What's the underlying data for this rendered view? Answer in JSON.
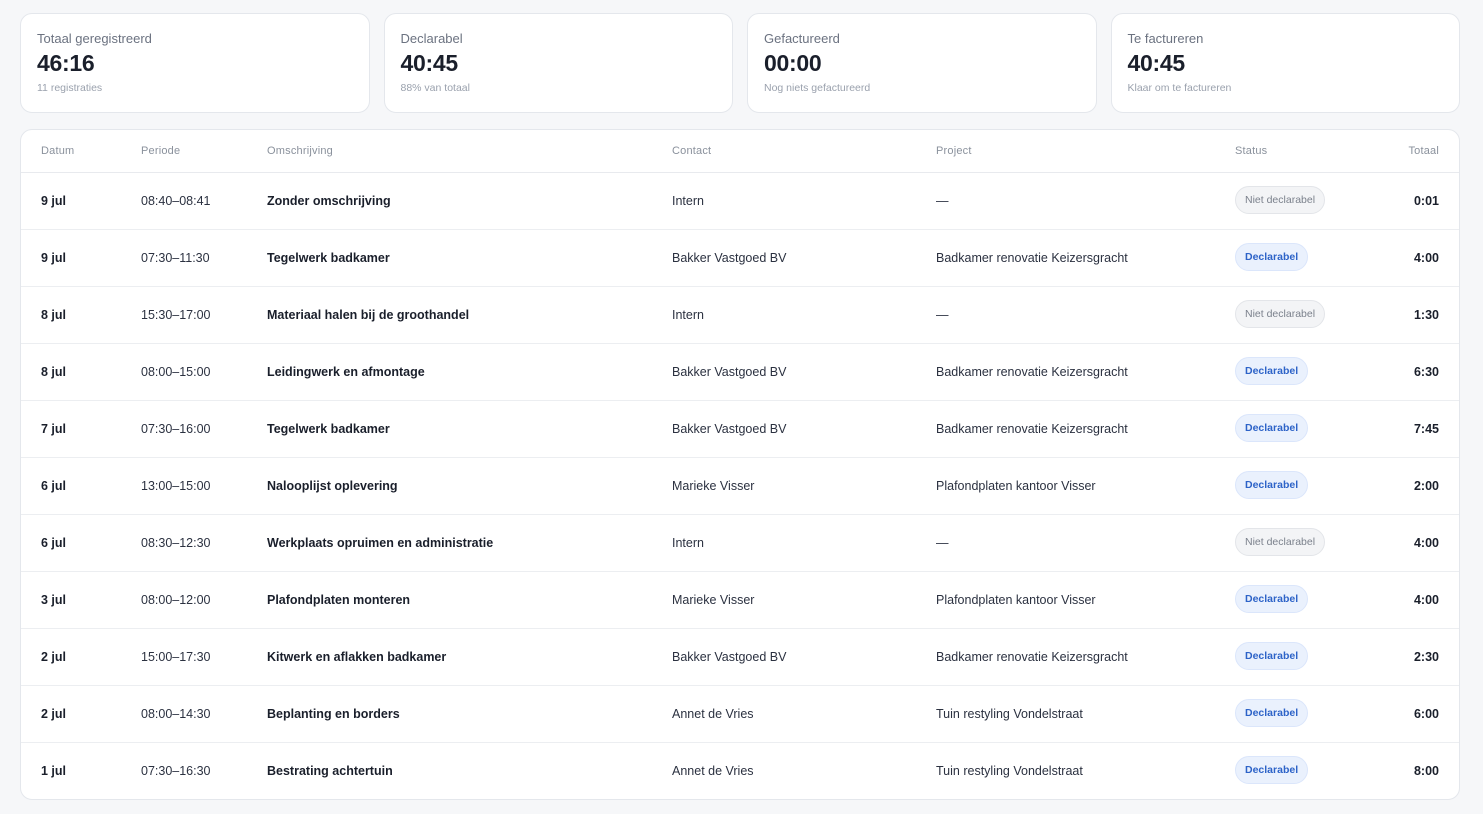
{
  "stats": [
    {
      "label": "Totaal geregistreerd",
      "value": "46:16",
      "sub": "11 registraties"
    },
    {
      "label": "Declarabel",
      "value": "40:45",
      "sub": "88% van totaal"
    },
    {
      "label": "Gefactureerd",
      "value": "00:00",
      "sub": "Nog niets gefactureerd"
    },
    {
      "label": "Te factureren",
      "value": "40:45",
      "sub": "Klaar om te factureren"
    }
  ],
  "table": {
    "headers": {
      "date": "Datum",
      "period": "Periode",
      "description": "Omschrijving",
      "contact": "Contact",
      "project": "Project",
      "status": "Status",
      "total": "Totaal"
    },
    "rows": [
      {
        "date": "9 jul",
        "period": "08:40–08:41",
        "description": "Zonder omschrijving",
        "contact": "Intern",
        "project": "—",
        "status": "Niet declarabel",
        "billable": false,
        "total": "0:01"
      },
      {
        "date": "9 jul",
        "period": "07:30–11:30",
        "description": "Tegelwerk badkamer",
        "contact": "Bakker Vastgoed BV",
        "project": "Badkamer renovatie Keizersgracht",
        "status": "Declarabel",
        "billable": true,
        "total": "4:00"
      },
      {
        "date": "8 jul",
        "period": "15:30–17:00",
        "description": "Materiaal halen bij de groothandel",
        "contact": "Intern",
        "project": "—",
        "status": "Niet declarabel",
        "billable": false,
        "total": "1:30"
      },
      {
        "date": "8 jul",
        "period": "08:00–15:00",
        "description": "Leidingwerk en afmontage",
        "contact": "Bakker Vastgoed BV",
        "project": "Badkamer renovatie Keizersgracht",
        "status": "Declarabel",
        "billable": true,
        "total": "6:30"
      },
      {
        "date": "7 jul",
        "period": "07:30–16:00",
        "description": "Tegelwerk badkamer",
        "contact": "Bakker Vastgoed BV",
        "project": "Badkamer renovatie Keizersgracht",
        "status": "Declarabel",
        "billable": true,
        "total": "7:45"
      },
      {
        "date": "6 jul",
        "period": "13:00–15:00",
        "description": "Nalooplijst oplevering",
        "contact": "Marieke Visser",
        "project": "Plafondplaten kantoor Visser",
        "status": "Declarabel",
        "billable": true,
        "total": "2:00"
      },
      {
        "date": "6 jul",
        "period": "08:30–12:30",
        "description": "Werkplaats opruimen en administratie",
        "contact": "Intern",
        "project": "—",
        "status": "Niet declarabel",
        "billable": false,
        "total": "4:00"
      },
      {
        "date": "3 jul",
        "period": "08:00–12:00",
        "description": "Plafondplaten monteren",
        "contact": "Marieke Visser",
        "project": "Plafondplaten kantoor Visser",
        "status": "Declarabel",
        "billable": true,
        "total": "4:00"
      },
      {
        "date": "2 jul",
        "period": "15:00–17:30",
        "description": "Kitwerk en aflakken badkamer",
        "contact": "Bakker Vastgoed BV",
        "project": "Badkamer renovatie Keizersgracht",
        "status": "Declarabel",
        "billable": true,
        "total": "2:30"
      },
      {
        "date": "2 jul",
        "period": "08:00–14:30",
        "description": "Beplanting en borders",
        "contact": "Annet de Vries",
        "project": "Tuin restyling Vondelstraat",
        "status": "Declarabel",
        "billable": true,
        "total": "6:00"
      },
      {
        "date": "1 jul",
        "period": "07:30–16:30",
        "description": "Bestrating achtertuin",
        "contact": "Annet de Vries",
        "project": "Tuin restyling Vondelstraat",
        "status": "Declarabel",
        "billable": true,
        "total": "8:00"
      }
    ]
  }
}
